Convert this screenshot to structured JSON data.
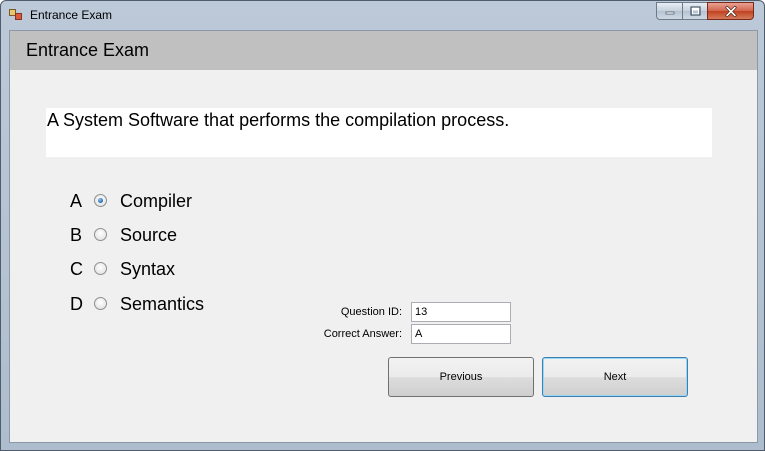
{
  "window": {
    "title": "Entrance Exam",
    "icon": "app-window-icon",
    "caption_buttons": [
      "minimize-icon",
      "maximize-icon",
      "close-icon"
    ]
  },
  "header": {
    "title": "Entrance Exam"
  },
  "question": {
    "text": "A System Software that performs the compilation process."
  },
  "options": [
    {
      "letter": "A",
      "label": "Compiler",
      "selected": true
    },
    {
      "letter": "B",
      "label": "Source",
      "selected": false
    },
    {
      "letter": "C",
      "label": "Syntax",
      "selected": false
    },
    {
      "letter": "D",
      "label": "Semantics",
      "selected": false
    }
  ],
  "fields": {
    "question_id_label": "Question ID:",
    "question_id_value": "13",
    "correct_answer_label": "Correct Answer:",
    "correct_answer_value": "A"
  },
  "buttons": {
    "previous": "Previous",
    "next": "Next"
  },
  "colors": {
    "header_band": "#c0c0c0",
    "client_bg": "#f0f0f0",
    "radio_accent": "#2b6fb5"
  }
}
